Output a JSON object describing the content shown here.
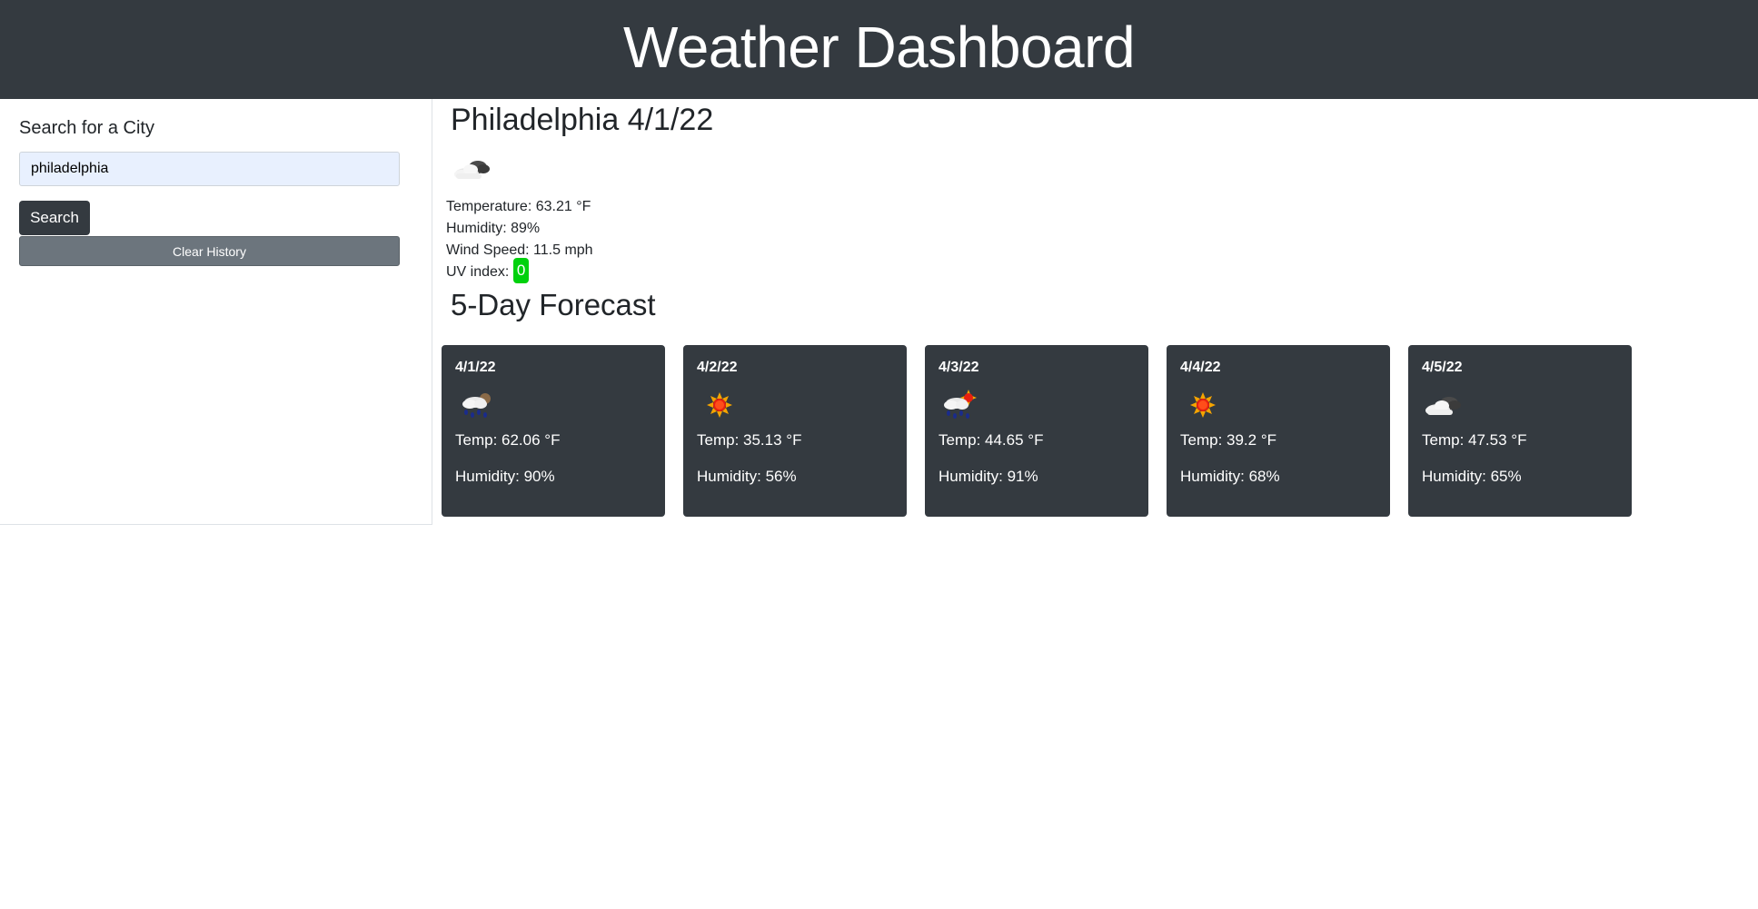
{
  "header": {
    "title": "Weather Dashboard"
  },
  "sidebar": {
    "label": "Search for a City",
    "search_value": "philadelphia",
    "search_button": "Search",
    "clear_button": "Clear History"
  },
  "current": {
    "title": "Philadelphia 4/1/22",
    "icon": "cloud-icon",
    "temperature": "Temperature: 63.21 °F",
    "humidity": "Humidity: 89%",
    "wind": "Wind Speed: 11.5 mph",
    "uv_label": "UV index: ",
    "uv_value": "0",
    "uv_color": "#00d10d"
  },
  "forecast": {
    "title": "5-Day Forecast",
    "days": [
      {
        "date": "4/1/22",
        "icon": "rain-icon",
        "temp": "Temp: 62.06 °F",
        "humidity": "Humidity: 90%"
      },
      {
        "date": "4/2/22",
        "icon": "sun-icon",
        "temp": "Temp: 35.13 °F",
        "humidity": "Humidity: 56%"
      },
      {
        "date": "4/3/22",
        "icon": "rain-sun-icon",
        "temp": "Temp: 44.65 °F",
        "humidity": "Humidity: 91%"
      },
      {
        "date": "4/4/22",
        "icon": "sun-icon",
        "temp": "Temp: 39.2 °F",
        "humidity": "Humidity: 68%"
      },
      {
        "date": "4/5/22",
        "icon": "cloud-icon",
        "temp": "Temp: 47.53 °F",
        "humidity": "Humidity: 65%"
      }
    ]
  },
  "colors": {
    "header_bg": "#343a40",
    "card_bg": "#343a40",
    "clear_button_bg": "#6c757d",
    "input_bg": "#e8f0fe"
  }
}
